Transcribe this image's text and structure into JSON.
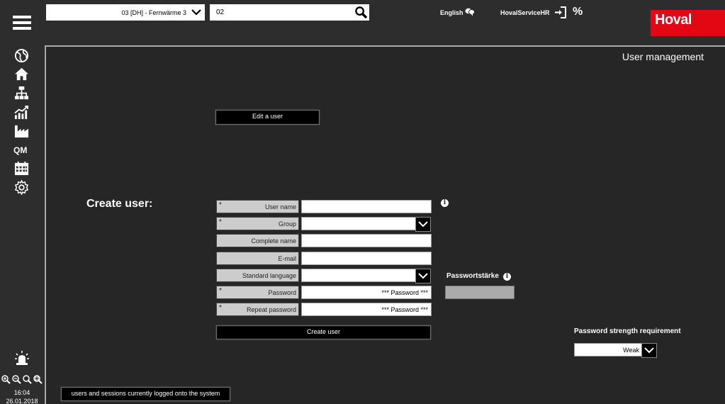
{
  "header": {
    "plant_select": "03 [DH] - Fernwärme 3",
    "search_value": "02",
    "language": "English",
    "user": "HovalServiceHR",
    "logo": "Hoval"
  },
  "sidebar": {
    "icons": [
      "globe-icon",
      "home-icon",
      "hierarchy-icon",
      "chart-icon",
      "factory-icon",
      "QM",
      "calendar-icon",
      "gear-icon"
    ],
    "qm_label": "QM",
    "time": "16:04",
    "date": "26.01.2018"
  },
  "main": {
    "page_title": "User management",
    "edit_user_button": "Edit a user",
    "create_title": "Create user:",
    "form": {
      "user_name": "User name",
      "group": "Group",
      "complete_name": "Complete name",
      "email": "E-mail",
      "standard_language": "Standard language",
      "password": "Password",
      "repeat_password": "Repeat password",
      "password_value": "*** Password ***",
      "repeat_password_value": "*** Password ***",
      "required_marker": "*"
    },
    "create_user_button": "Create user",
    "password_strength_label": "Passwortstärke",
    "strength_requirement_label": "Password strength requirement",
    "strength_requirement_value": "Weak",
    "sessions_button": "users and sessions currently logged onto the system"
  }
}
